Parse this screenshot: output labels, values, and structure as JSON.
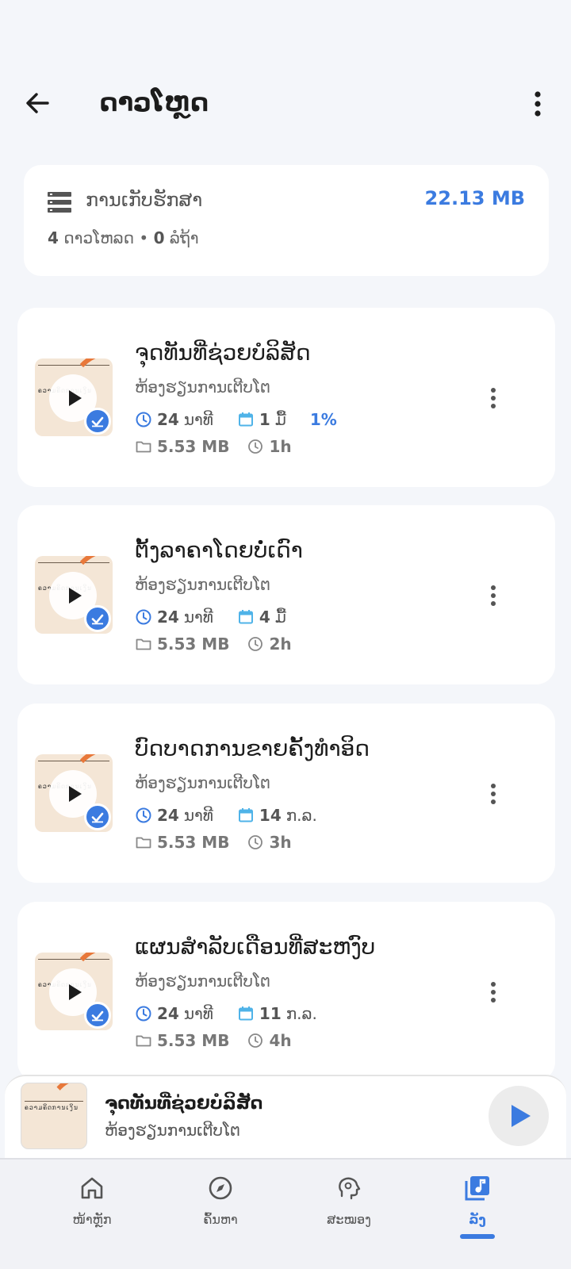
{
  "header": {
    "title": "ດາວໂຫຼດ"
  },
  "storage": {
    "label": "ການເກັບຮັກສາ",
    "size": "22.13 MB",
    "downloads_count": "4",
    "downloads_label": "ດາວໂຫລດ",
    "separator": "•",
    "queue_count": "0",
    "queue_label": "ລໍຖ້າ"
  },
  "downloads": [
    {
      "title": "ຈຸດທັນທີ່ຊ່ວຍບໍລິສັດ",
      "subtitle": "ຫ້ອງຮຽນການເຕີບໂຕ",
      "duration_value": "24",
      "duration_unit": "ນາທີ",
      "date_value": "1",
      "date_unit": "ມື້",
      "progress": "1%",
      "size": "5.53 MB",
      "ago": "1h"
    },
    {
      "title": "ຕັ້ງລາຄາໂດຍບໍ່ເດົາ",
      "subtitle": "ຫ້ອງຮຽນການເຕີບໂຕ",
      "duration_value": "24",
      "duration_unit": "ນາທີ",
      "date_value": "4",
      "date_unit": "ມື້",
      "progress": "",
      "size": "5.53 MB",
      "ago": "2h"
    },
    {
      "title": "ບົດບາດການຂາຍຄັ້ງທຳອິດ",
      "subtitle": "ຫ້ອງຮຽນການເຕີບໂຕ",
      "duration_value": "24",
      "duration_unit": "ນາທີ",
      "date_value": "14",
      "date_unit": "ກ.ລ.",
      "progress": "",
      "size": "5.53 MB",
      "ago": "3h"
    },
    {
      "title": "ແຜນສຳລັບເດືອນທີ່ສະຫງົບ",
      "subtitle": "ຫ້ອງຮຽນການເຕີບໂຕ",
      "duration_value": "24",
      "duration_unit": "ນາທີ",
      "date_value": "11",
      "date_unit": "ກ.ລ.",
      "progress": "",
      "size": "5.53 MB",
      "ago": "4h"
    }
  ],
  "thumb_text": "ຄວາມຄິດການເງິນ",
  "mini_player": {
    "title": "ຈຸດທັນທີ່ຊ່ວຍບໍລິສັດ",
    "subtitle": "ຫ້ອງຮຽນການເຕີບໂຕ"
  },
  "nav": [
    {
      "label": "ໜ້າຫຼັກ",
      "icon": "home-icon"
    },
    {
      "label": "ຄົ້ນຫາ",
      "icon": "compass-icon"
    },
    {
      "label": "ສະໝອງ",
      "icon": "brain-icon"
    },
    {
      "label": "ລັງ",
      "icon": "library-music-icon",
      "active": true
    }
  ],
  "colors": {
    "accent": "#3b7be0",
    "orange": "#e8783a",
    "background": "#f4f6fa"
  }
}
